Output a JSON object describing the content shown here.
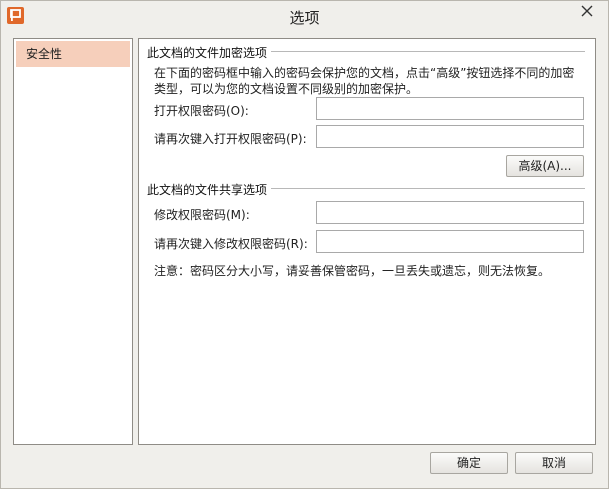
{
  "window": {
    "title": "选项"
  },
  "sidebar": {
    "items": [
      {
        "label": "安全性"
      }
    ]
  },
  "encryption": {
    "section_title": "此文档的文件加密选项",
    "description": "在下面的密码框中输入的密码会保护您的文档，点击“高级”按钮选择不同的加密类型，可以为您的文档设置不同级别的加密保护。",
    "open_password_label": "打开权限密码(O):",
    "open_password_value": "",
    "confirm_open_password_label": "请再次键入打开权限密码(P):",
    "confirm_open_password_value": "",
    "advanced_button": "高级(A)..."
  },
  "sharing": {
    "section_title": "此文档的文件共享选项",
    "modify_password_label": "修改权限密码(M):",
    "modify_password_value": "",
    "confirm_modify_password_label": "请再次键入修改权限密码(R):",
    "confirm_modify_password_value": ""
  },
  "note": "注意：密码区分大小写，请妥善保管密码，一旦丢失或遗忘，则无法恢复。",
  "footer": {
    "ok_button": "确定",
    "cancel_button": "取消"
  },
  "colors": {
    "selected_item": "#f6cfbb",
    "app_icon": "#e0682a"
  },
  "icons": {
    "app": "wps-presentation-icon",
    "close": "close-icon"
  }
}
